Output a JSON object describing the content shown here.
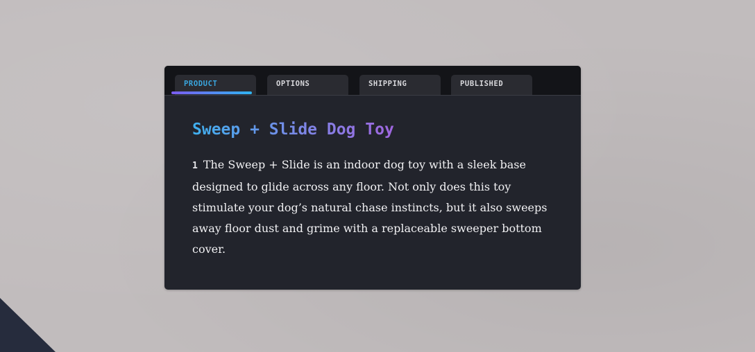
{
  "tabs": [
    {
      "label": "PRODUCT",
      "active": true
    },
    {
      "label": "OPTIONS",
      "active": false
    },
    {
      "label": "SHIPPING",
      "active": false
    },
    {
      "label": "PUBLISHED",
      "active": false
    }
  ],
  "product": {
    "title": "Sweep + Slide Dog Toy",
    "paragraph_number": "1",
    "description": "The Sweep + Slide is an indoor dog toy with a sleek base designed to glide across any floor. Not only does this toy stimulate your dog’s natural chase instincts, but it also sweeps away floor dust and grime with a replaceable sweeper bottom cover."
  },
  "colors": {
    "active_tab": "#3aa7e0",
    "panel_bg": "#22242c",
    "tab_bar_bg": "#131418",
    "indicator_gradient": [
      "#7b5cf0",
      "#2fb4f0"
    ],
    "page_bg": "#c1bcbd"
  }
}
